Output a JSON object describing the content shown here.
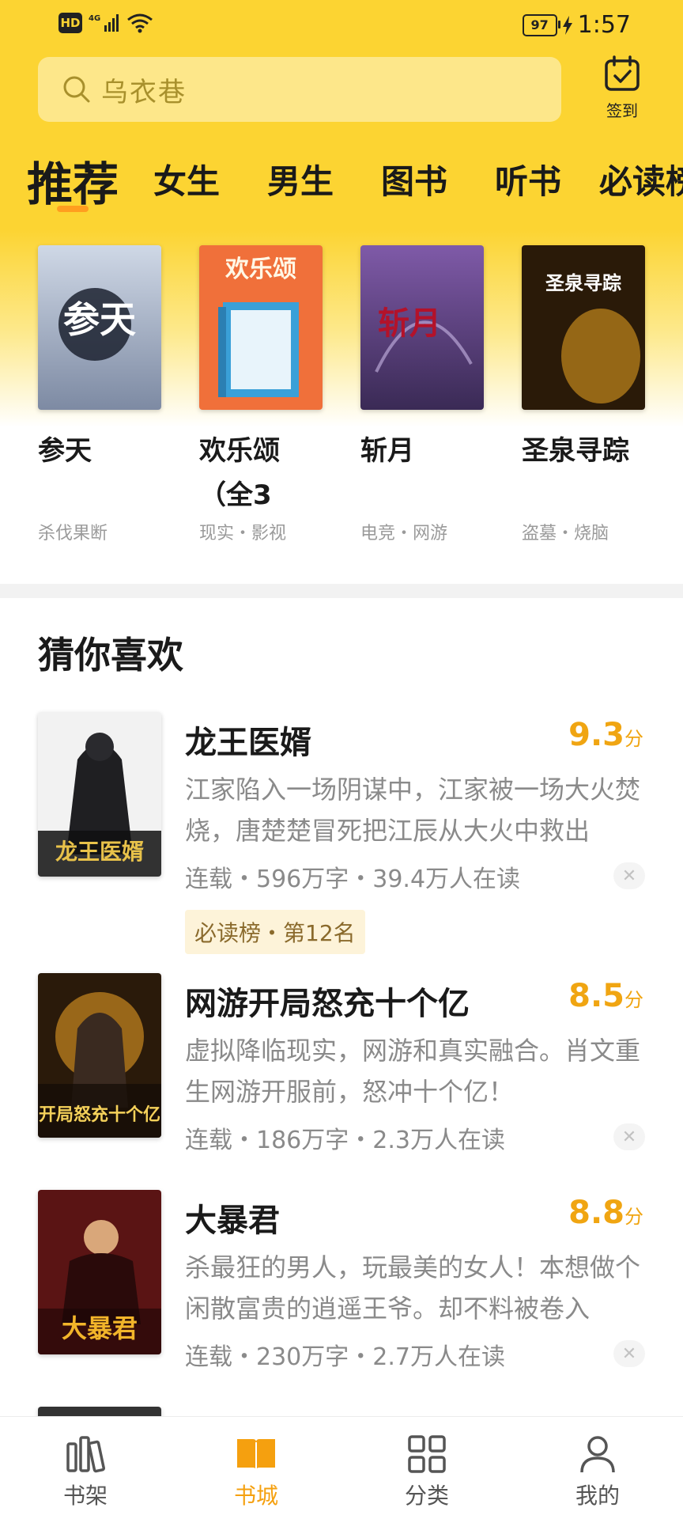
{
  "status_bar": {
    "hd": "HD",
    "network": "4G",
    "battery": "97",
    "time": "1:57"
  },
  "search": {
    "placeholder": "乌衣巷"
  },
  "checkin": {
    "label": "签到"
  },
  "tabs": [
    "推荐",
    "女生",
    "男生",
    "图书",
    "听书",
    "必读榜"
  ],
  "active_tab": 0,
  "featured_books": [
    {
      "title": "参天",
      "tags": "杀伐果断",
      "cover_text": "参天"
    },
    {
      "title": "欢乐颂（全3",
      "tags": "现实・影视",
      "cover_text": "欢乐颂"
    },
    {
      "title": "斩月",
      "tags": "电竞・网游",
      "cover_text": "斩月"
    },
    {
      "title": "圣泉寻踪",
      "tags": "盗墓・烧脑",
      "cover_text": "圣泉寻踪"
    }
  ],
  "section": {
    "title": "猜你喜欢"
  },
  "recommendations": [
    {
      "name": "龙王医婿",
      "score": "9.3",
      "score_unit": "分",
      "desc": "江家陷入一场阴谋中，江家被一场大火焚烧，唐楚楚冒死把江辰从大火中救出",
      "meta": "连载・596万字・39.4万人在读",
      "badge": "必读榜・第12名",
      "cover_text": "龙王医婿"
    },
    {
      "name": "网游开局怒充十个亿",
      "score": "8.5",
      "score_unit": "分",
      "desc": "虚拟降临现实，网游和真实融合。肖文重生网游开服前，怒冲十个亿！",
      "meta": "连载・186万字・2.3万人在读",
      "badge": "",
      "cover_text": "开局怒充十个亿"
    },
    {
      "name": "大暴君",
      "score": "8.8",
      "score_unit": "分",
      "desc": "杀最狂的男人，玩最美的女人！本想做个闲散富贵的逍遥王爷。却不料被卷入",
      "meta": "连载・230万字・2.7万人在读",
      "badge": "",
      "cover_text": "大暴君"
    }
  ],
  "bottom_nav": [
    {
      "label": "书架",
      "icon": "bookshelf-icon"
    },
    {
      "label": "书城",
      "icon": "bookstore-icon"
    },
    {
      "label": "分类",
      "icon": "category-grid-icon"
    },
    {
      "label": "我的",
      "icon": "profile-icon"
    }
  ],
  "active_nav": 1,
  "colors": {
    "accent": "#fcd432",
    "active_nav": "#f5a00f",
    "score": "#f0a512"
  }
}
